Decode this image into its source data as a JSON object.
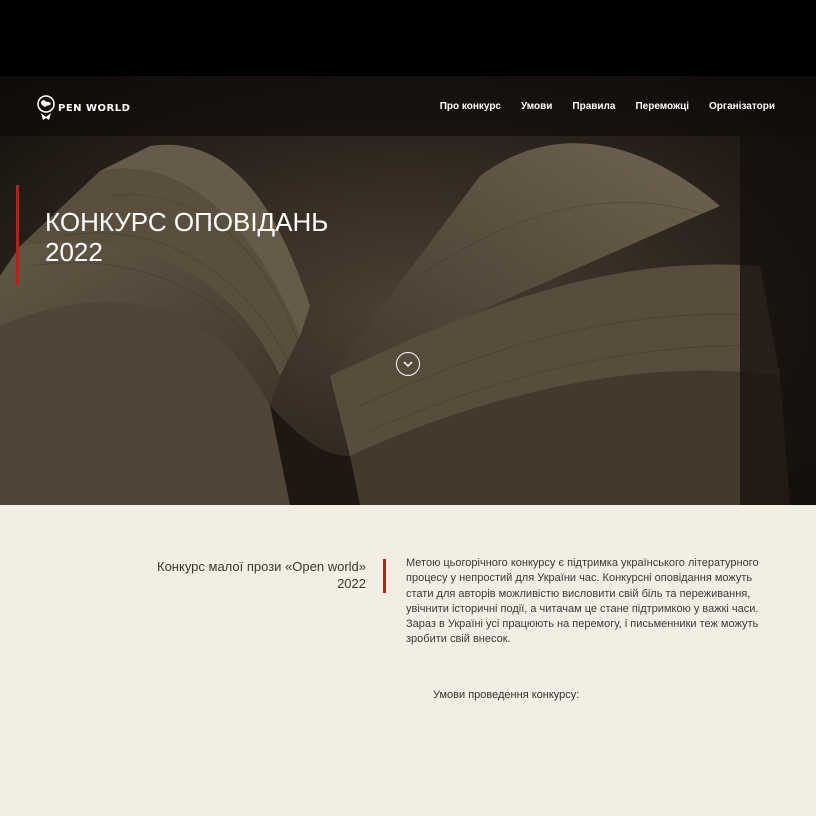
{
  "header": {
    "logo_text": "PEN WORLD",
    "nav": [
      {
        "label": "Про конкурс"
      },
      {
        "label": "Умови"
      },
      {
        "label": "Правила"
      },
      {
        "label": "Переможці"
      },
      {
        "label": "Організатори"
      }
    ]
  },
  "hero": {
    "title": "КОНКУРС ОПОВІДАНЬ 2022",
    "scroll_icon": "chevron-down-icon"
  },
  "intro": {
    "subtitle": "Конкурс малої прози «Open world» 2022",
    "description": "Метою цьогорічного конкурсу є підтримка українського літературного процесу у непростий для України час. Конкурсні оповідання можуть стати для авторів можливістю висловити свій біль та переживання, увічнити історичні події, а читачам це стане підтримкою у важкі часи. Зараз в Україні усі працюють на перемогу, і письменники теж можуть зробити свій внесок."
  },
  "conditions": {
    "heading": "Умови проведення конкурсу:"
  },
  "colors": {
    "accent": "#b5201c",
    "background": "#f3eee3",
    "topbar": "#000000"
  }
}
